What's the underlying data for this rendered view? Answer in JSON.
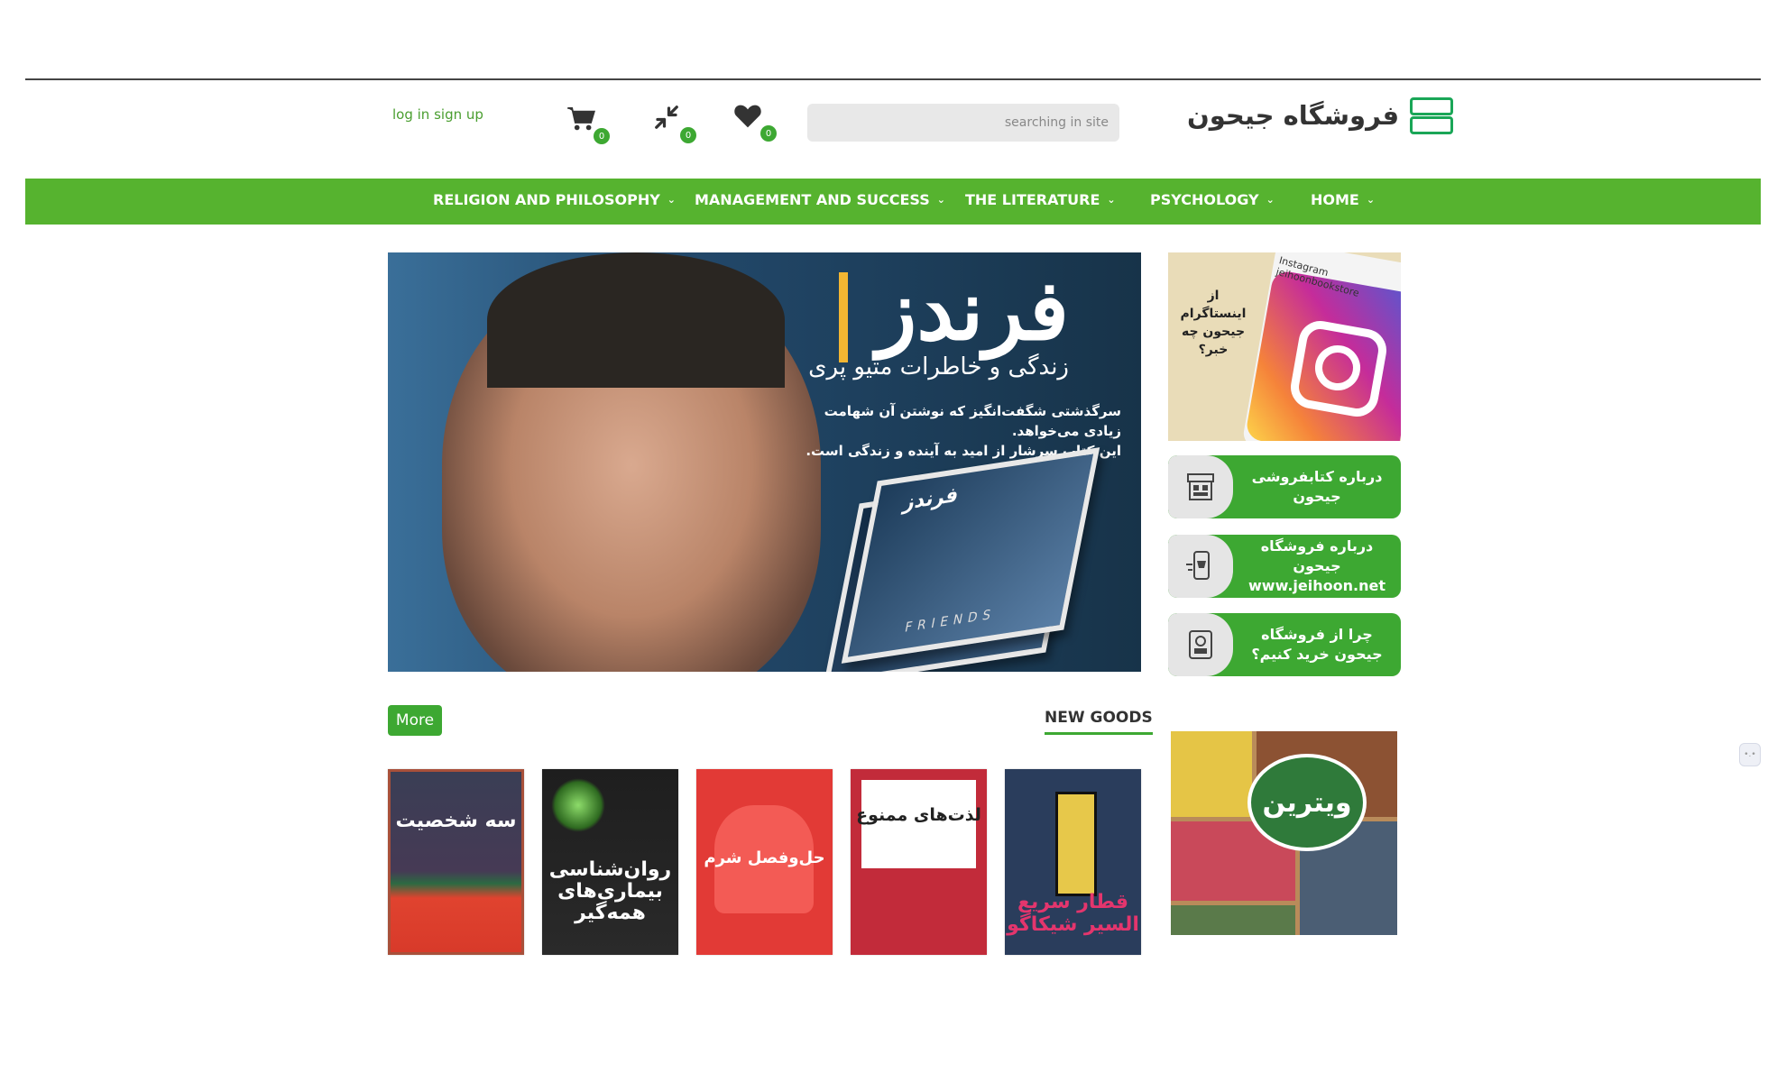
{
  "header": {
    "logo_text": "فروشگاه جیحون",
    "search_placeholder": "searching in site",
    "wishlist_count": "0",
    "compare_count": "0",
    "cart_count": "0",
    "login_label": "log in",
    "signup_label": "sign up",
    "icons": [
      "heart-icon",
      "compare-icon",
      "cart-icon"
    ]
  },
  "nav": {
    "items": [
      {
        "label": "RELIGION AND PHILOSOPHY"
      },
      {
        "label": "MANAGEMENT AND SUCCESS"
      },
      {
        "label": "THE LITERATURE"
      },
      {
        "label": "PSYCHOLOGY"
      },
      {
        "label": "HOME"
      }
    ],
    "chevron": "⌄"
  },
  "hero": {
    "title": "فرندز",
    "subtitle": "زندگی و خاطرات متیو پری",
    "description_line1": "سرگذشتی شگفت‌انگیز که نوشتن آن شهامت زیادی می‌خواهد.",
    "description_line2": "این کتاب سرشار از امید به آینده و زندگی است.",
    "book_title": "فرندز",
    "book_spine": "FRIENDS"
  },
  "sidebar": {
    "instagram_text": "از اینستاگرام جیحون چه خبر؟",
    "instagram_handle": "jeihoonbookstore",
    "instagram_label": "Instagram",
    "buttons": [
      {
        "label": "درباره کتابفروشی جیحون",
        "icon": "store-icon"
      },
      {
        "label": "درباره فروشگاه جیحون www.jeihoon.net",
        "icon": "mobile-shop-icon"
      },
      {
        "label": "چرا از فروشگاه جیحون خرید کنیم؟",
        "icon": "tablet-cart-icon"
      }
    ],
    "vitrin_label": "ویترین"
  },
  "section": {
    "title": "NEW GOODS",
    "more_label": "More"
  },
  "books": [
    {
      "title": "سه شخصیت"
    },
    {
      "title": "روان‌شناسی بیماری‌های همه‌گیر"
    },
    {
      "title": "حل‌وفصل شرم"
    },
    {
      "title": "لذت‌های ممنوع"
    },
    {
      "title": "قطار سریع السیر شیکاگو"
    }
  ],
  "colors": {
    "brand_green": "#56b32f",
    "button_green": "#3da832"
  }
}
